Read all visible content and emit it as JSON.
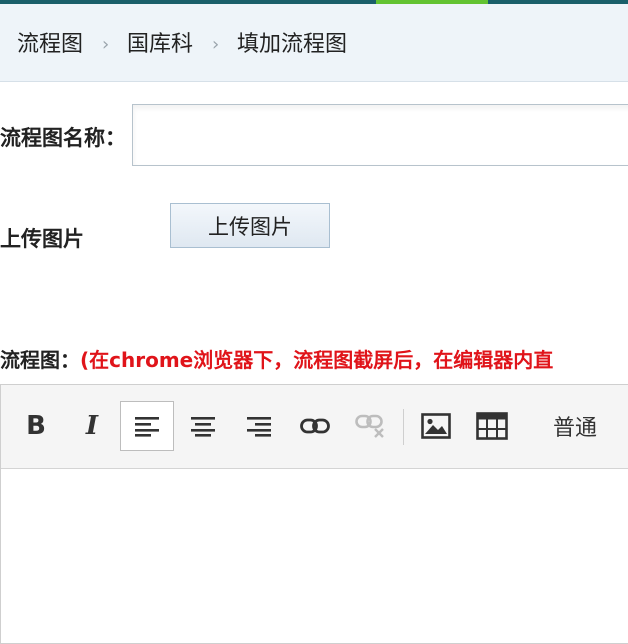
{
  "breadcrumb": {
    "items": [
      "流程图",
      "国库科",
      "填加流程图"
    ],
    "separator": "›"
  },
  "form": {
    "name_label": "流程图名称：",
    "name_value": "",
    "upload_label": "上传图片",
    "upload_button": "上传图片",
    "flowchart_label": "流程图：",
    "flowchart_hint": "(在chrome浏览器下，流程图截屏后，在编辑器内直"
  },
  "editor": {
    "toolbar": {
      "bold": "B",
      "italic": "I",
      "icons": [
        "bold-icon",
        "italic-icon",
        "align-left-icon",
        "align-center-icon",
        "align-right-icon",
        "link-icon",
        "unlink-icon",
        "image-icon",
        "table-icon"
      ],
      "paragraph_format": "普通",
      "active_tool": "align-left-icon"
    },
    "content": ""
  },
  "colors": {
    "topbar_dark": "#1a5f6a",
    "topbar_green": "#63c332",
    "breadcrumb_bg": "#eef4f9",
    "hint_red": "#e0141a"
  }
}
